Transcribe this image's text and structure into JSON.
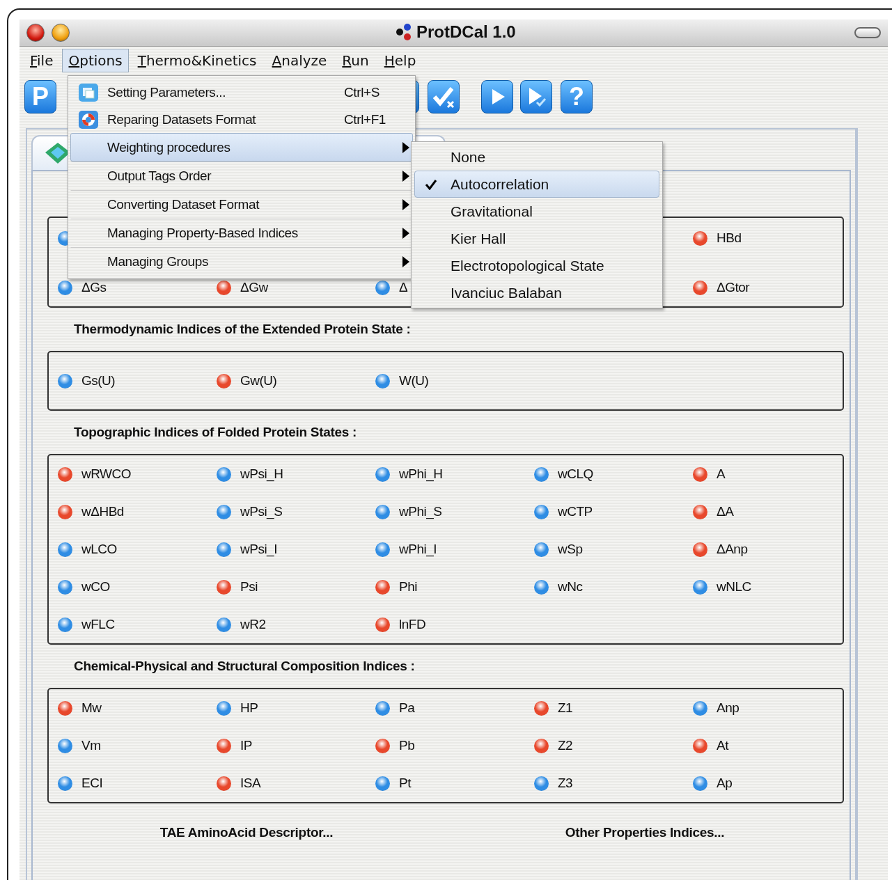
{
  "window": {
    "title": "ProtDCal 1.0"
  },
  "menu_bar": [
    {
      "label": "File",
      "selected": false
    },
    {
      "label": "Options",
      "selected": true
    },
    {
      "label": "Thermo&Kinetics",
      "selected": false
    },
    {
      "label": "Analyze",
      "selected": false
    },
    {
      "label": "Run",
      "selected": false
    },
    {
      "label": "Help",
      "selected": false
    }
  ],
  "toolbar": [
    {
      "kind": "letter",
      "text": "P"
    },
    {
      "kind": "partial"
    },
    {
      "kind": "check-x"
    },
    {
      "kind": "play"
    },
    {
      "kind": "play-check"
    },
    {
      "kind": "letter",
      "text": "?"
    }
  ],
  "options_menu": [
    {
      "label": "Setting Parameters...",
      "shortcut": "Ctrl+S",
      "kind": "window",
      "selected": false,
      "submenu": false
    },
    {
      "label": "Reparing  Datasets Format",
      "shortcut": "Ctrl+F1",
      "kind": "lifebuoy",
      "selected": false,
      "submenu": false
    },
    {
      "label": "Weighting procedures",
      "selected": true,
      "submenu": true
    },
    {
      "label": "Output Tags Order",
      "selected": false,
      "submenu": true
    },
    {
      "label": "Converting Dataset Format",
      "selected": false,
      "submenu": true
    },
    {
      "label": "Managing Property-Based Indices",
      "selected": false,
      "submenu": true
    },
    {
      "label": "Managing Groups",
      "selected": false,
      "submenu": true
    }
  ],
  "weighting_submenu": [
    {
      "label": "None",
      "checked": false,
      "selected": false
    },
    {
      "label": "Autocorrelation",
      "checked": true,
      "selected": true
    },
    {
      "label": "Gravitational",
      "checked": false,
      "selected": false
    },
    {
      "label": "Kier Hall",
      "checked": false,
      "selected": false
    },
    {
      "label": "Electrotopological State",
      "checked": false,
      "selected": false
    },
    {
      "label": "Ivanciuc Balaban",
      "checked": false,
      "selected": false
    }
  ],
  "groups": [
    {
      "rows": [
        [
          {
            "color": "#2f8de4"
          },
          null,
          null,
          null,
          {
            "label": "HBd",
            "color": "#e8482c"
          }
        ],
        [
          {
            "label": "ΔGs",
            "color": "#2f8de4"
          },
          {
            "label": "ΔGw",
            "color": "#e8482c"
          },
          {
            "label": "Δ",
            "color": "#2f8de4"
          },
          null,
          {
            "label": "ΔGtor",
            "color": "#e8482c"
          }
        ]
      ]
    },
    {
      "heading": "Thermodynamic Indices of the Extended Protein State :",
      "rows": [
        [
          {
            "label": "Gs(U)",
            "color": "#2f8de4"
          },
          {
            "label": "Gw(U)",
            "color": "#e8482c"
          },
          {
            "label": "W(U)",
            "color": "#2f8de4"
          }
        ]
      ]
    },
    {
      "heading": "Topographic Indices of Folded Protein States :",
      "rows": [
        [
          {
            "label": "wRWCO",
            "color": "#e8482c"
          },
          {
            "label": "wPsi_H",
            "color": "#2f8de4"
          },
          {
            "label": "wPhi_H",
            "color": "#2f8de4"
          },
          {
            "label": "wCLQ",
            "color": "#2f8de4"
          },
          {
            "label": "A",
            "color": "#e8482c"
          }
        ],
        [
          {
            "label": "wΔHBd",
            "color": "#e8482c"
          },
          {
            "label": "wPsi_S",
            "color": "#2f8de4"
          },
          {
            "label": "wPhi_S",
            "color": "#2f8de4"
          },
          {
            "label": "wCTP",
            "color": "#2f8de4"
          },
          {
            "label": "ΔA",
            "color": "#e8482c"
          }
        ],
        [
          {
            "label": "wLCO",
            "color": "#2f8de4"
          },
          {
            "label": "wPsi_I",
            "color": "#2f8de4"
          },
          {
            "label": "wPhi_I",
            "color": "#2f8de4"
          },
          {
            "label": "wSp",
            "color": "#2f8de4"
          },
          {
            "label": "ΔAnp",
            "color": "#e8482c"
          }
        ],
        [
          {
            "label": "wCO",
            "color": "#2f8de4"
          },
          {
            "label": "Psi",
            "color": "#e8482c"
          },
          {
            "label": "Phi",
            "color": "#e8482c"
          },
          {
            "label": "wNc",
            "color": "#2f8de4"
          },
          {
            "label": "wNLC",
            "color": "#2f8de4"
          }
        ],
        [
          {
            "label": "wFLC",
            "color": "#2f8de4"
          },
          {
            "label": "wR2",
            "color": "#2f8de4"
          },
          {
            "label": "lnFD",
            "color": "#e8482c"
          }
        ]
      ]
    },
    {
      "heading": "Chemical-Physical and Structural Composition Indices :",
      "rows": [
        [
          {
            "label": "Mw",
            "color": "#e8482c"
          },
          {
            "label": "HP",
            "color": "#2f8de4"
          },
          {
            "label": "Pa",
            "color": "#2f8de4"
          },
          {
            "label": "Z1",
            "color": "#e8482c"
          },
          {
            "label": "Anp",
            "color": "#2f8de4"
          }
        ],
        [
          {
            "label": "Vm",
            "color": "#2f8de4"
          },
          {
            "label": "IP",
            "color": "#e8482c"
          },
          {
            "label": "Pb",
            "color": "#e8482c"
          },
          {
            "label": "Z2",
            "color": "#e8482c"
          },
          {
            "label": "At",
            "color": "#e8482c"
          }
        ],
        [
          {
            "label": "ECI",
            "color": "#2f8de4"
          },
          {
            "label": "ISA",
            "color": "#e8482c"
          },
          {
            "label": "Pt",
            "color": "#2f8de4"
          },
          {
            "label": "Z3",
            "color": "#2f8de4"
          },
          {
            "label": "Ap",
            "color": "#2f8de4"
          }
        ]
      ]
    }
  ],
  "footer_links": [
    "TAE AminoAcid Descriptor...",
    "Other Properties Indices..."
  ]
}
